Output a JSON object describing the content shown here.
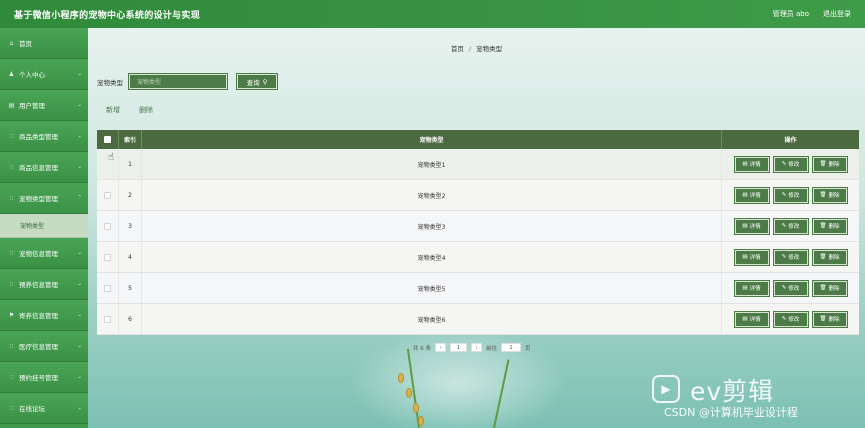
{
  "header": {
    "title": "基于微信小程序的宠物中心系统的设计与实现",
    "admin_label": "管理员 abo",
    "logout_label": "退出登录"
  },
  "sidebar": {
    "items": [
      {
        "label": "首页",
        "icon": "home-icon",
        "chevron": false
      },
      {
        "label": "个人中心",
        "icon": "user-icon",
        "chevron": true
      },
      {
        "label": "用户管理",
        "icon": "list-icon",
        "chevron": true
      },
      {
        "label": "商品类型管理",
        "icon": "grid-icon",
        "chevron": true
      },
      {
        "label": "商品信息管理",
        "icon": "grid-icon",
        "chevron": true
      },
      {
        "label": "宠物类型管理",
        "icon": "grid-icon",
        "chevron": true
      },
      {
        "label": "宠物信息管理",
        "icon": "grid-icon",
        "chevron": true
      },
      {
        "label": "预养信息管理",
        "icon": "grid-icon",
        "chevron": true
      },
      {
        "label": "寄养信息管理",
        "icon": "flag-icon",
        "chevron": true
      },
      {
        "label": "医疗信息管理",
        "icon": "grid-icon",
        "chevron": true
      },
      {
        "label": "预约挂号管理",
        "icon": "grid-icon",
        "chevron": true
      },
      {
        "label": "在线论坛",
        "icon": "grid-icon",
        "chevron": true
      }
    ],
    "sub_item": "宠物类型"
  },
  "breadcrumb": {
    "home": "首页",
    "sep": "/",
    "current": "宠物类型"
  },
  "search": {
    "label": "宠物类型",
    "placeholder": "宠物类型",
    "button_label": "查询"
  },
  "actions": {
    "add_label": "新增",
    "delete_label": "删除"
  },
  "table": {
    "headers": {
      "index": "索引",
      "type": "宠物类型",
      "ops": "操作"
    },
    "rows": [
      {
        "index": "1",
        "type": "宠物类型1"
      },
      {
        "index": "2",
        "type": "宠物类型2"
      },
      {
        "index": "3",
        "type": "宠物类型3"
      },
      {
        "index": "4",
        "type": "宠物类型4"
      },
      {
        "index": "5",
        "type": "宠物类型5"
      },
      {
        "index": "6",
        "type": "宠物类型6"
      }
    ],
    "ops": {
      "detail": "详情",
      "edit": "修改",
      "delete": "删除"
    }
  },
  "pager": {
    "total": "共 6 条",
    "prev": "‹",
    "page": "1",
    "next": "›",
    "goto": "前往",
    "goto_value": "1",
    "page_suffix": "页"
  },
  "watermark": {
    "logo_text": "▶",
    "brand": "ev剪辑",
    "csdn": "CSDN @计算机毕业设计程"
  },
  "colors": {
    "accent": "#4c7b48",
    "topbar": "#2f8a3a",
    "sidebar": "#3f9a4a"
  }
}
